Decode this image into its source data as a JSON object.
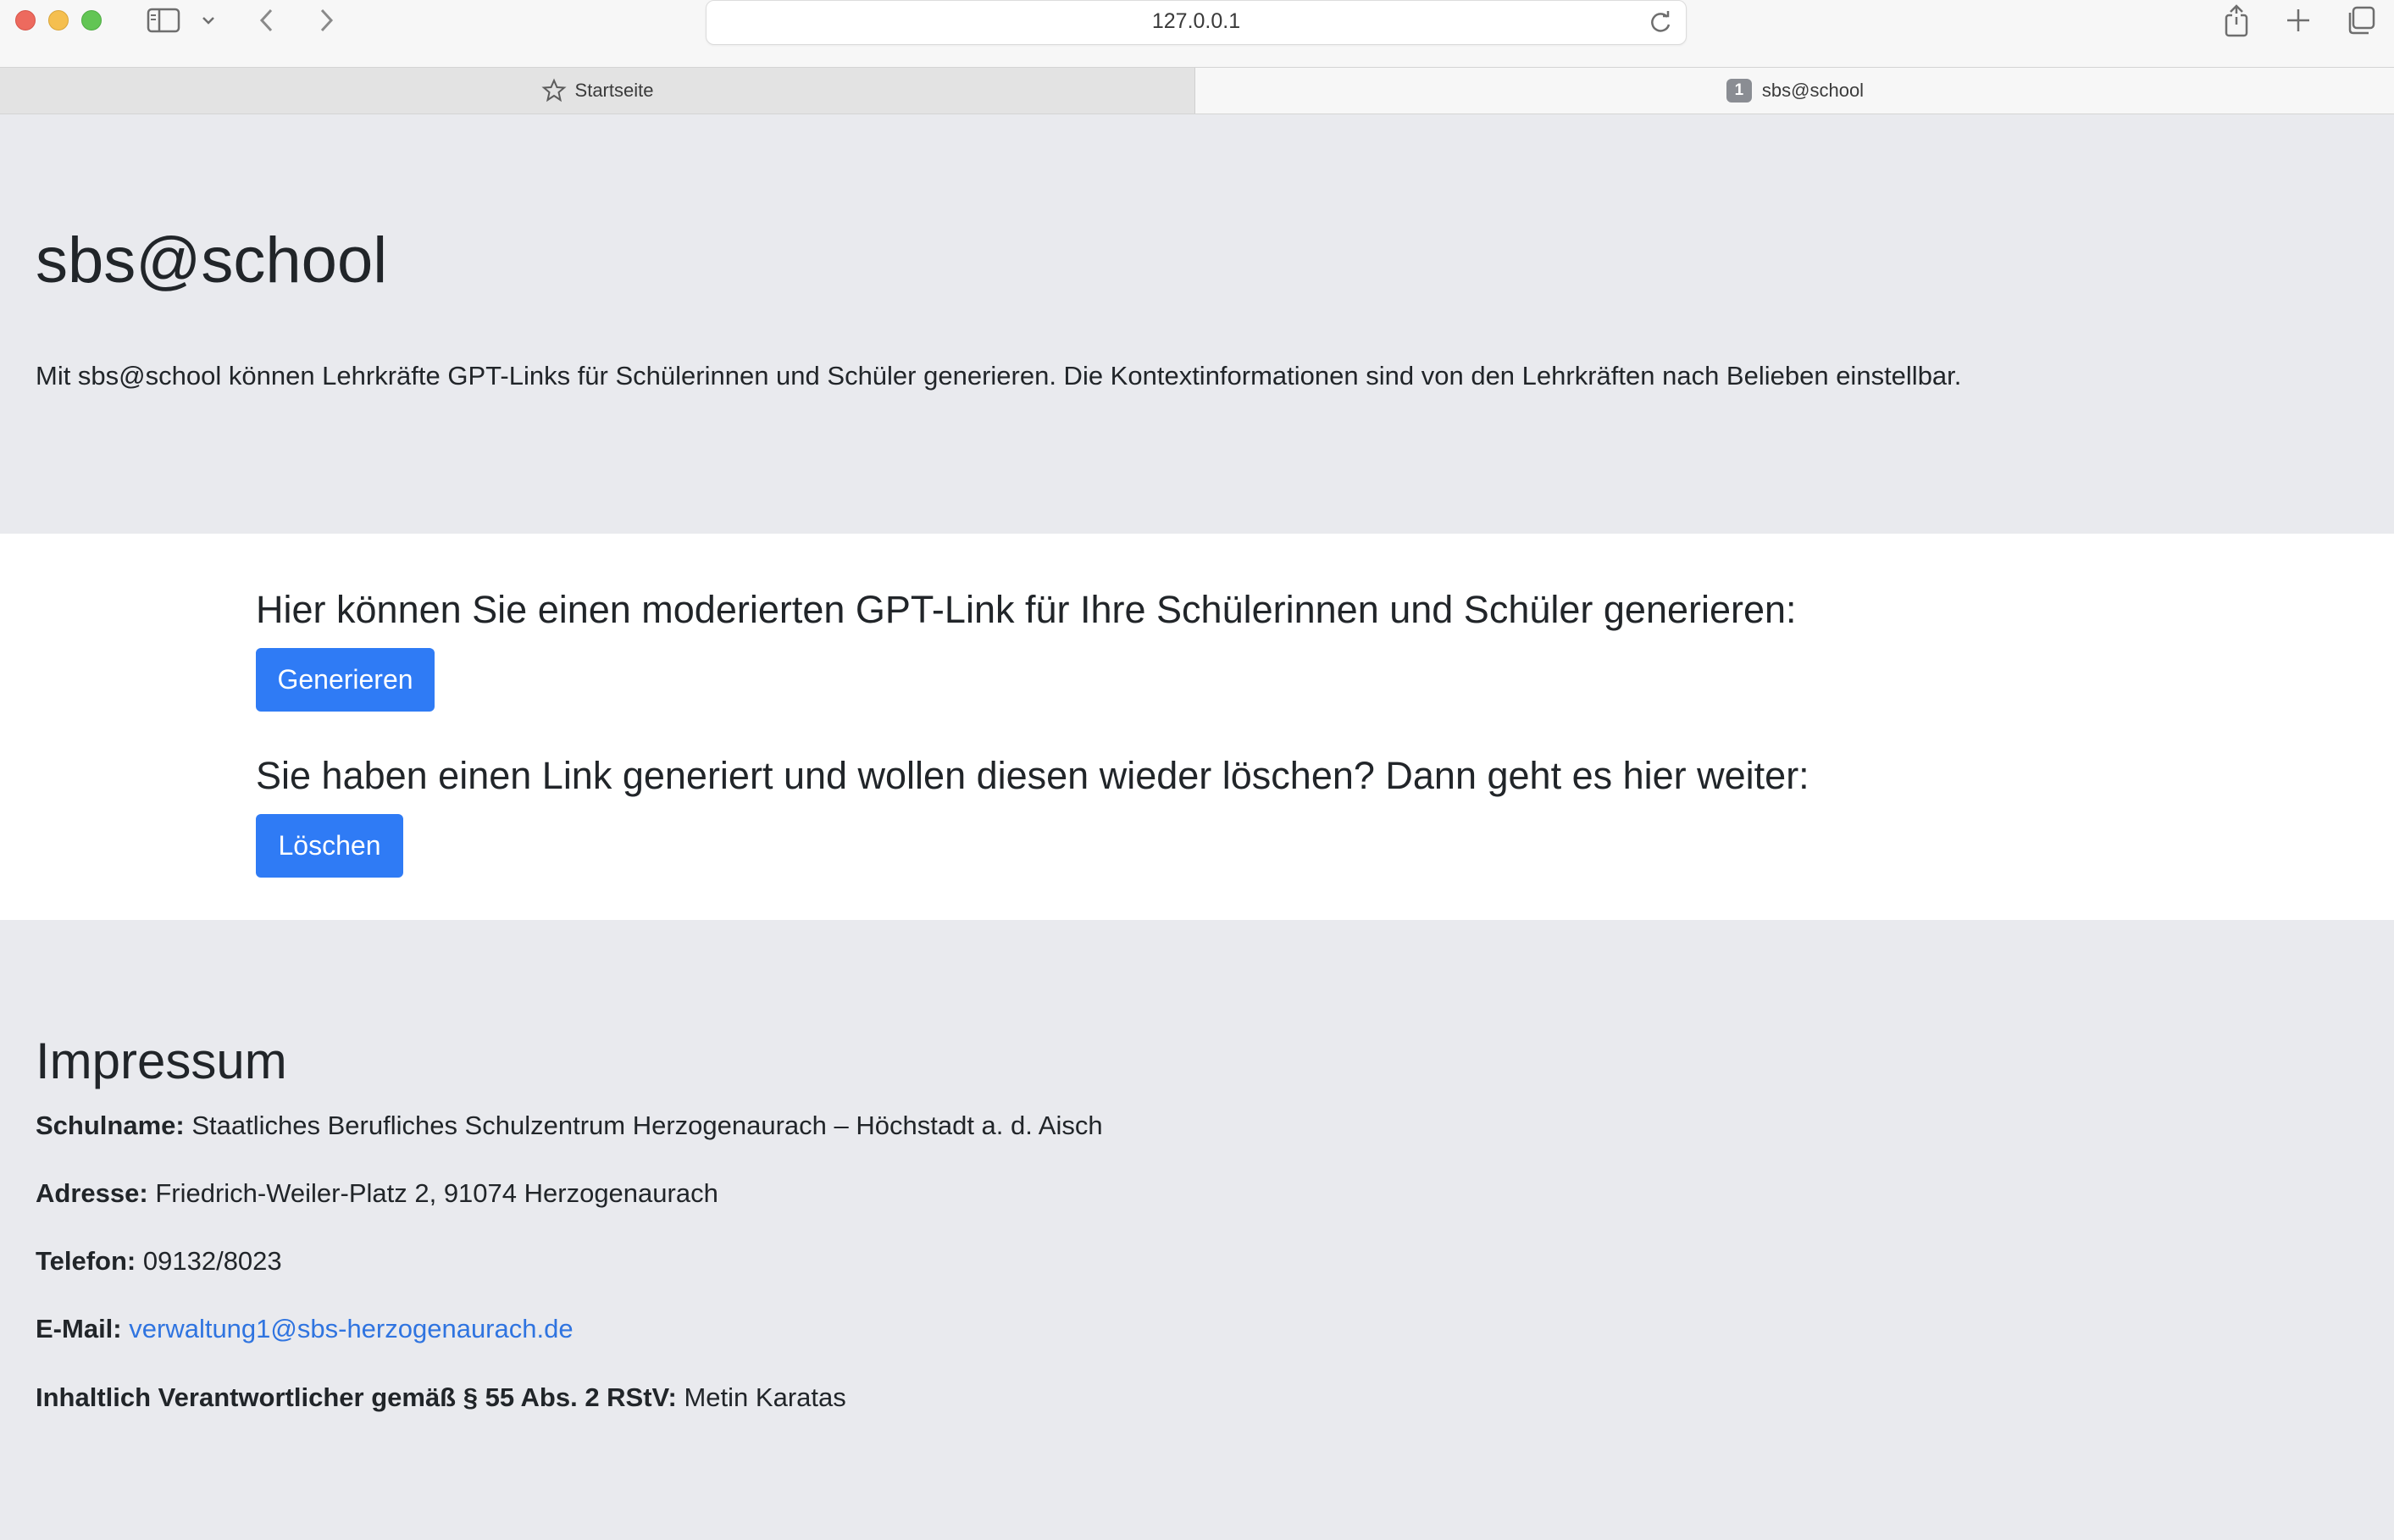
{
  "browser": {
    "url": "127.0.0.1",
    "tabs": [
      {
        "label": "Startseite"
      },
      {
        "label": "sbs@school",
        "badge": "1"
      }
    ]
  },
  "hero": {
    "title": "sbs@school",
    "lead": "Mit sbs@school können Lehrkräfte GPT-Links für Schülerinnen und Schüler generieren. Die Kontextinformationen sind von den Lehrkräften nach Belieben einstellbar."
  },
  "actions": {
    "generate_heading": "Hier können Sie einen moderierten GPT-Link für Ihre Schülerinnen und Schüler generieren:",
    "generate_button": "Generieren",
    "delete_heading": "Sie haben einen Link generiert und wollen diesen wieder löschen? Dann geht es hier weiter:",
    "delete_button": "Löschen"
  },
  "impressum": {
    "title": "Impressum",
    "school_label": "Schulname:",
    "school_value": "Staatliches Berufliches Schulzentrum Herzogenaurach – Höchstadt a. d. Aisch",
    "address_label": "Adresse:",
    "address_value": "Friedrich-Weiler-Platz 2, 91074 Herzogenaurach",
    "phone_label": "Telefon:",
    "phone_value": "09132/8023",
    "email_label": "E-Mail:",
    "email_value": "verwaltung1@sbs-herzogenaurach.de",
    "responsible_label": "Inhaltlich Verantwortlicher gemäß § 55 Abs. 2 RStV:",
    "responsible_value": "Metin Karatas"
  },
  "colors": {
    "accent": "#2f7bf5",
    "link": "#2f74e0",
    "page_bg": "#e9eaee"
  }
}
